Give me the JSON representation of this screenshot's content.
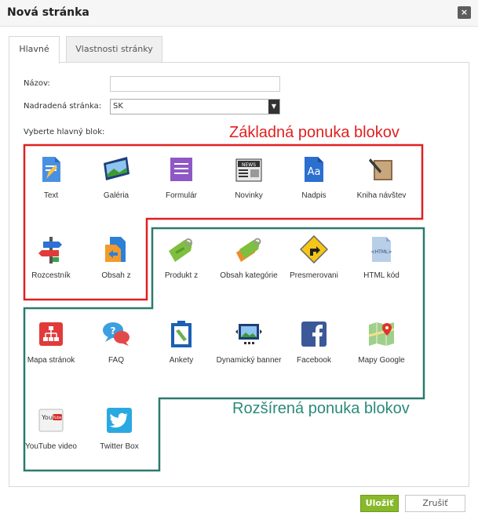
{
  "dialog": {
    "title": "Nová stránka",
    "close_symbol": "×"
  },
  "tabs": [
    {
      "label": "Hlavné",
      "active": true
    },
    {
      "label": "Vlastnosti stránky",
      "active": false
    }
  ],
  "form": {
    "name_label": "Názov:",
    "name_value": "",
    "parent_label": "Nadradená stránka:",
    "parent_value": "SK",
    "block_prompt": "Vyberte hlavný blok:"
  },
  "annotations": {
    "basic": "Základná ponuka blokov",
    "extended": "Rozšírená ponuka blokov",
    "basic_color": "#e02020",
    "extended_color": "#2b8a7a"
  },
  "blocks": [
    {
      "label": "Text",
      "icon": "text-doc-icon"
    },
    {
      "label": "Galéria",
      "icon": "gallery-icon"
    },
    {
      "label": "Formulár",
      "icon": "form-icon"
    },
    {
      "label": "Novinky",
      "icon": "news-icon"
    },
    {
      "label": "Nadpis",
      "icon": "heading-icon"
    },
    {
      "label": "Kniha návštev",
      "icon": "guestbook-icon"
    },
    {
      "label": "Rozcestník",
      "icon": "signpost-icon"
    },
    {
      "label": "Obsah z",
      "icon": "content-from-icon"
    },
    {
      "label": "Produkt z",
      "icon": "product-tag-icon"
    },
    {
      "label": "Obsah kategórie",
      "icon": "category-tags-icon"
    },
    {
      "label": "Presmerovani",
      "icon": "redirect-sign-icon"
    },
    {
      "label": "HTML kód",
      "icon": "html-file-icon"
    },
    {
      "label": "Mapa stránok",
      "icon": "sitemap-icon"
    },
    {
      "label": "FAQ",
      "icon": "faq-bubbles-icon"
    },
    {
      "label": "Ankety",
      "icon": "poll-clipboard-icon"
    },
    {
      "label": "Dynamický banner",
      "icon": "banner-icon"
    },
    {
      "label": "Facebook",
      "icon": "facebook-icon"
    },
    {
      "label": "Mapy Google",
      "icon": "google-maps-icon"
    },
    {
      "label": "YouTube video",
      "icon": "youtube-icon"
    },
    {
      "label": "Twitter Box",
      "icon": "twitter-icon"
    }
  ],
  "buttons": {
    "save": "Uložiť",
    "cancel": "Zrušiť"
  }
}
